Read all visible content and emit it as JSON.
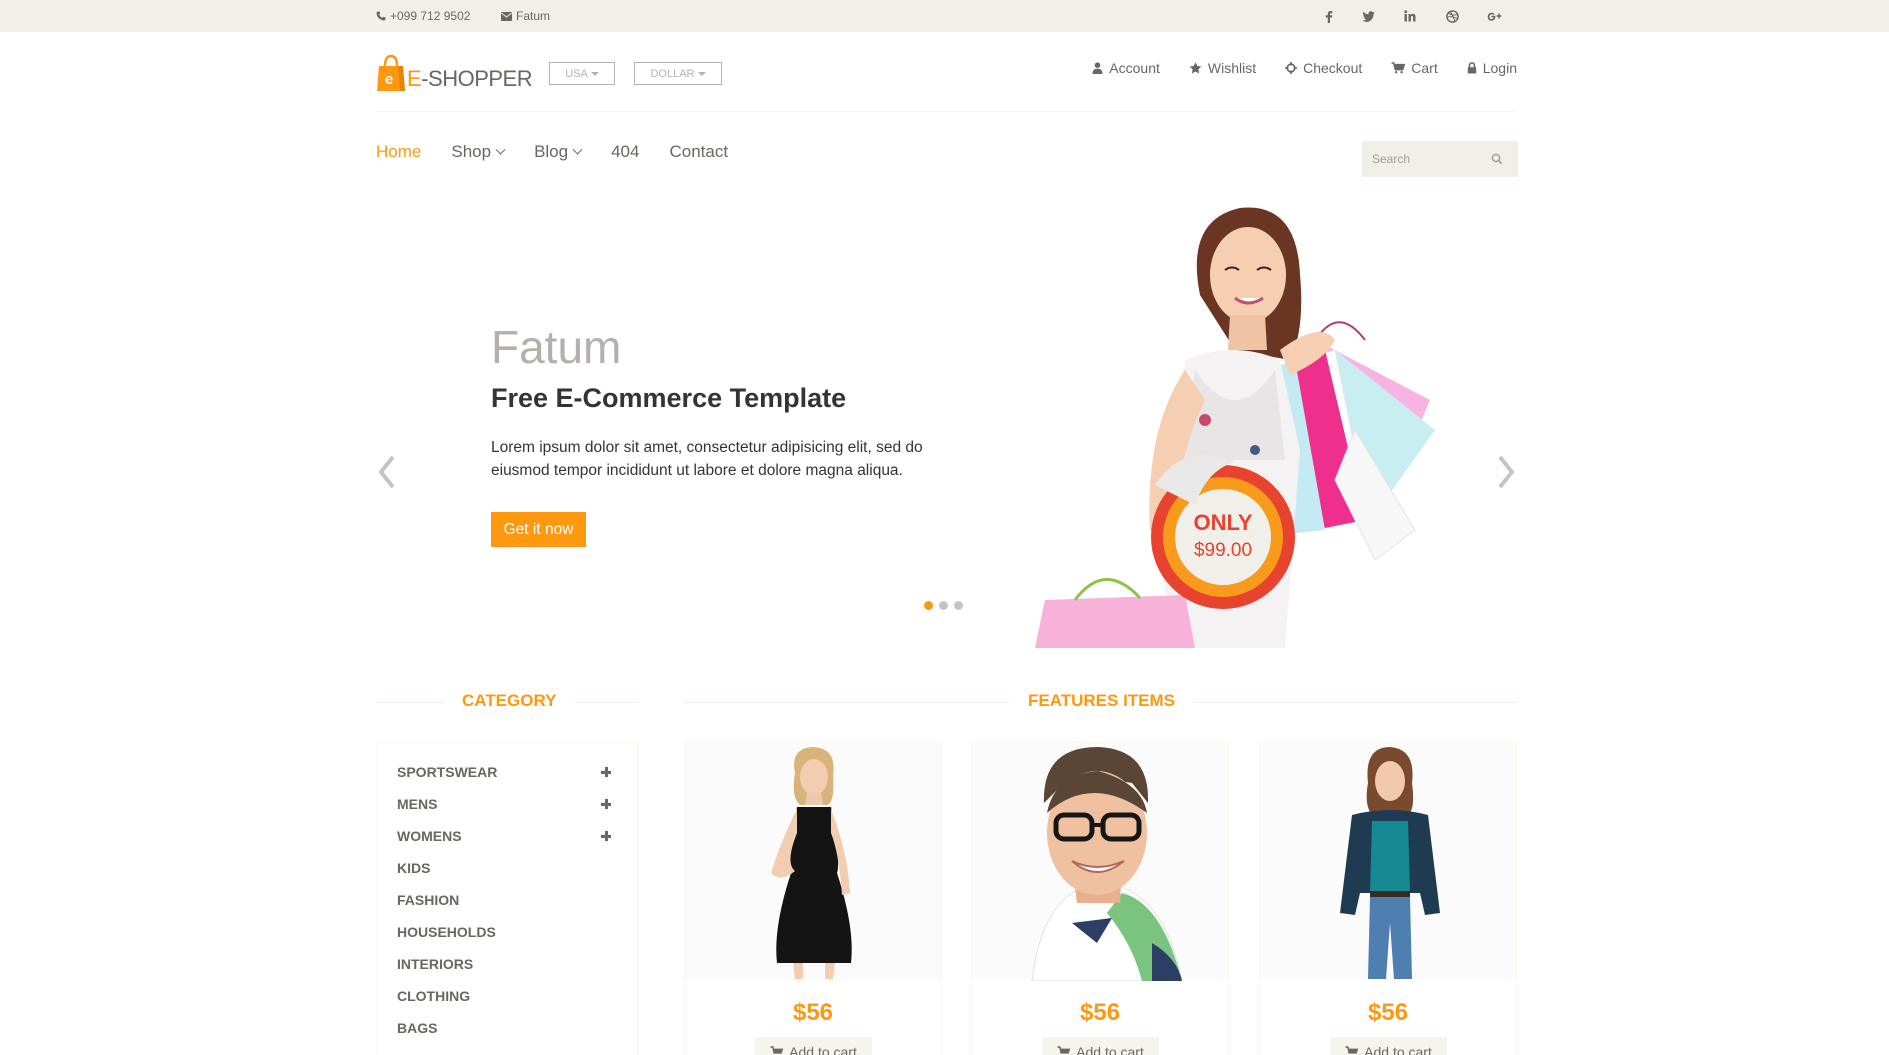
{
  "topbar": {
    "phone": "+099 712 9502",
    "email": "Fatum",
    "social": [
      "facebook-icon",
      "twitter-icon",
      "linkedin-icon",
      "dribbble-icon",
      "google-plus-icon"
    ]
  },
  "header": {
    "brand_e": "E",
    "brand_rest": "-SHOPPER",
    "country_label": "USA",
    "currency_label": "DOLLAR",
    "menu": [
      {
        "label": "Account",
        "icon": "user-icon"
      },
      {
        "label": "Wishlist",
        "icon": "star-icon"
      },
      {
        "label": "Checkout",
        "icon": "crosshairs-icon"
      },
      {
        "label": "Cart",
        "icon": "cart-icon"
      },
      {
        "label": "Login",
        "icon": "lock-icon"
      }
    ]
  },
  "nav": {
    "items": [
      {
        "label": "Home"
      },
      {
        "label": "Shop"
      },
      {
        "label": "Blog"
      },
      {
        "label": "404"
      },
      {
        "label": "Contact"
      }
    ],
    "search_placeholder": "Search"
  },
  "slider": {
    "title": "Fatum",
    "subtitle": "Free E-Commerce Template",
    "text": "Lorem ipsum dolor sit amet, consectetur adipisicing elit, sed do eiusmod tempor incididunt ut labore et dolore magna aliqua.",
    "button": "Get it now",
    "badge_top": "ONLY",
    "badge_price": "$99.00",
    "active_slide": 1,
    "slide_count": 3
  },
  "sections": {
    "category_title": "CATEGORY",
    "features_title": "FEATURES ITEMS"
  },
  "categories": [
    {
      "label": "SPORTSWEAR",
      "expandable": true
    },
    {
      "label": "MENS",
      "expandable": true
    },
    {
      "label": "WOMENS",
      "expandable": true
    },
    {
      "label": "KIDS",
      "expandable": false
    },
    {
      "label": "FASHION",
      "expandable": false
    },
    {
      "label": "HOUSEHOLDS",
      "expandable": false
    },
    {
      "label": "INTERIORS",
      "expandable": false
    },
    {
      "label": "CLOTHING",
      "expandable": false
    },
    {
      "label": "BAGS",
      "expandable": false
    }
  ],
  "products": [
    {
      "price": "$56",
      "button": "Add to cart"
    },
    {
      "price": "$56",
      "button": "Add to cart"
    },
    {
      "price": "$56",
      "button": "Add to cart"
    }
  ],
  "colors": {
    "accent": "#fe980f",
    "text": "#696763",
    "topbar_bg": "#f0f0e9"
  }
}
